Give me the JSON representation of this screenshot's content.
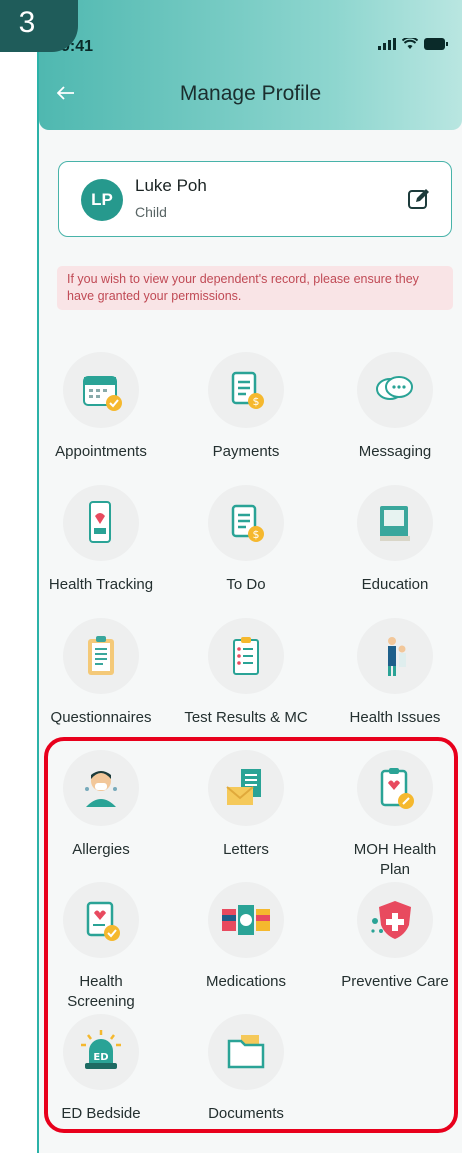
{
  "step": "3",
  "status": {
    "time": "9:41"
  },
  "header": {
    "title": "Manage Profile"
  },
  "profile": {
    "initials": "LP",
    "name": "Luke Poh",
    "role": "Child"
  },
  "notice": "If you wish to view your dependent's record, please ensure they have granted your permissions.",
  "tiles": [
    {
      "label": "Appointments",
      "icon": "calendar-icon"
    },
    {
      "label": "Payments",
      "icon": "bill-icon"
    },
    {
      "label": "Messaging",
      "icon": "chat-icon"
    },
    {
      "label": "Health Tracking",
      "icon": "health-tracking-icon"
    },
    {
      "label": "To Do",
      "icon": "todo-bill-icon"
    },
    {
      "label": "Education",
      "icon": "book-icon"
    },
    {
      "label": "Questionnaires",
      "icon": "clipboard-icon"
    },
    {
      "label": "Test Results & MC",
      "icon": "test-results-icon"
    },
    {
      "label": "Health Issues",
      "icon": "health-issues-icon"
    },
    {
      "label": "Allergies",
      "icon": "allergy-person-icon"
    },
    {
      "label": "Letters",
      "icon": "letters-icon"
    },
    {
      "label": "MOH Health Plan",
      "icon": "health-plan-icon"
    },
    {
      "label": "Health Screening",
      "icon": "screening-icon"
    },
    {
      "label": "Medications",
      "icon": "pills-icon"
    },
    {
      "label": "Preventive Care",
      "icon": "shield-icon"
    },
    {
      "label": "ED Bedside",
      "icon": "ed-siren-icon"
    },
    {
      "label": "Documents",
      "icon": "folder-icon"
    }
  ],
  "colors": {
    "accent": "#26998d",
    "highlight": "#e8001c",
    "notice_text": "#c04a55"
  }
}
